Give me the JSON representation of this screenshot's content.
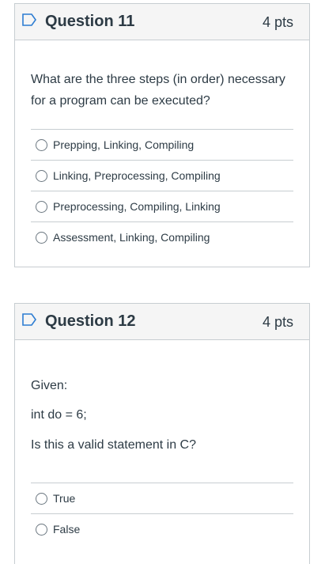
{
  "questions": [
    {
      "title": "Question 11",
      "points": "4 pts",
      "text_lines": [
        "What are the three steps (in order) necessary",
        "for a program can be executed?"
      ],
      "answers": [
        "Prepping, Linking, Compiling",
        "Linking, Preprocessing, Compiling",
        "Preprocessing, Compiling, Linking",
        "Assessment, Linking, Compiling"
      ]
    },
    {
      "title": "Question 12",
      "points": "4 pts",
      "text_lines": [
        "Given:",
        "int do = 6;",
        "Is this a valid statement in C?"
      ],
      "answers": [
        "True",
        "False"
      ]
    }
  ],
  "colors": {
    "flag": "#2d7dd2",
    "border": "#c7cdd1",
    "header_bg": "#f5f5f5",
    "text": "#2d3b45"
  },
  "icons": {
    "flag": "bookmark-flag-icon",
    "radio": "radio-empty-icon"
  }
}
